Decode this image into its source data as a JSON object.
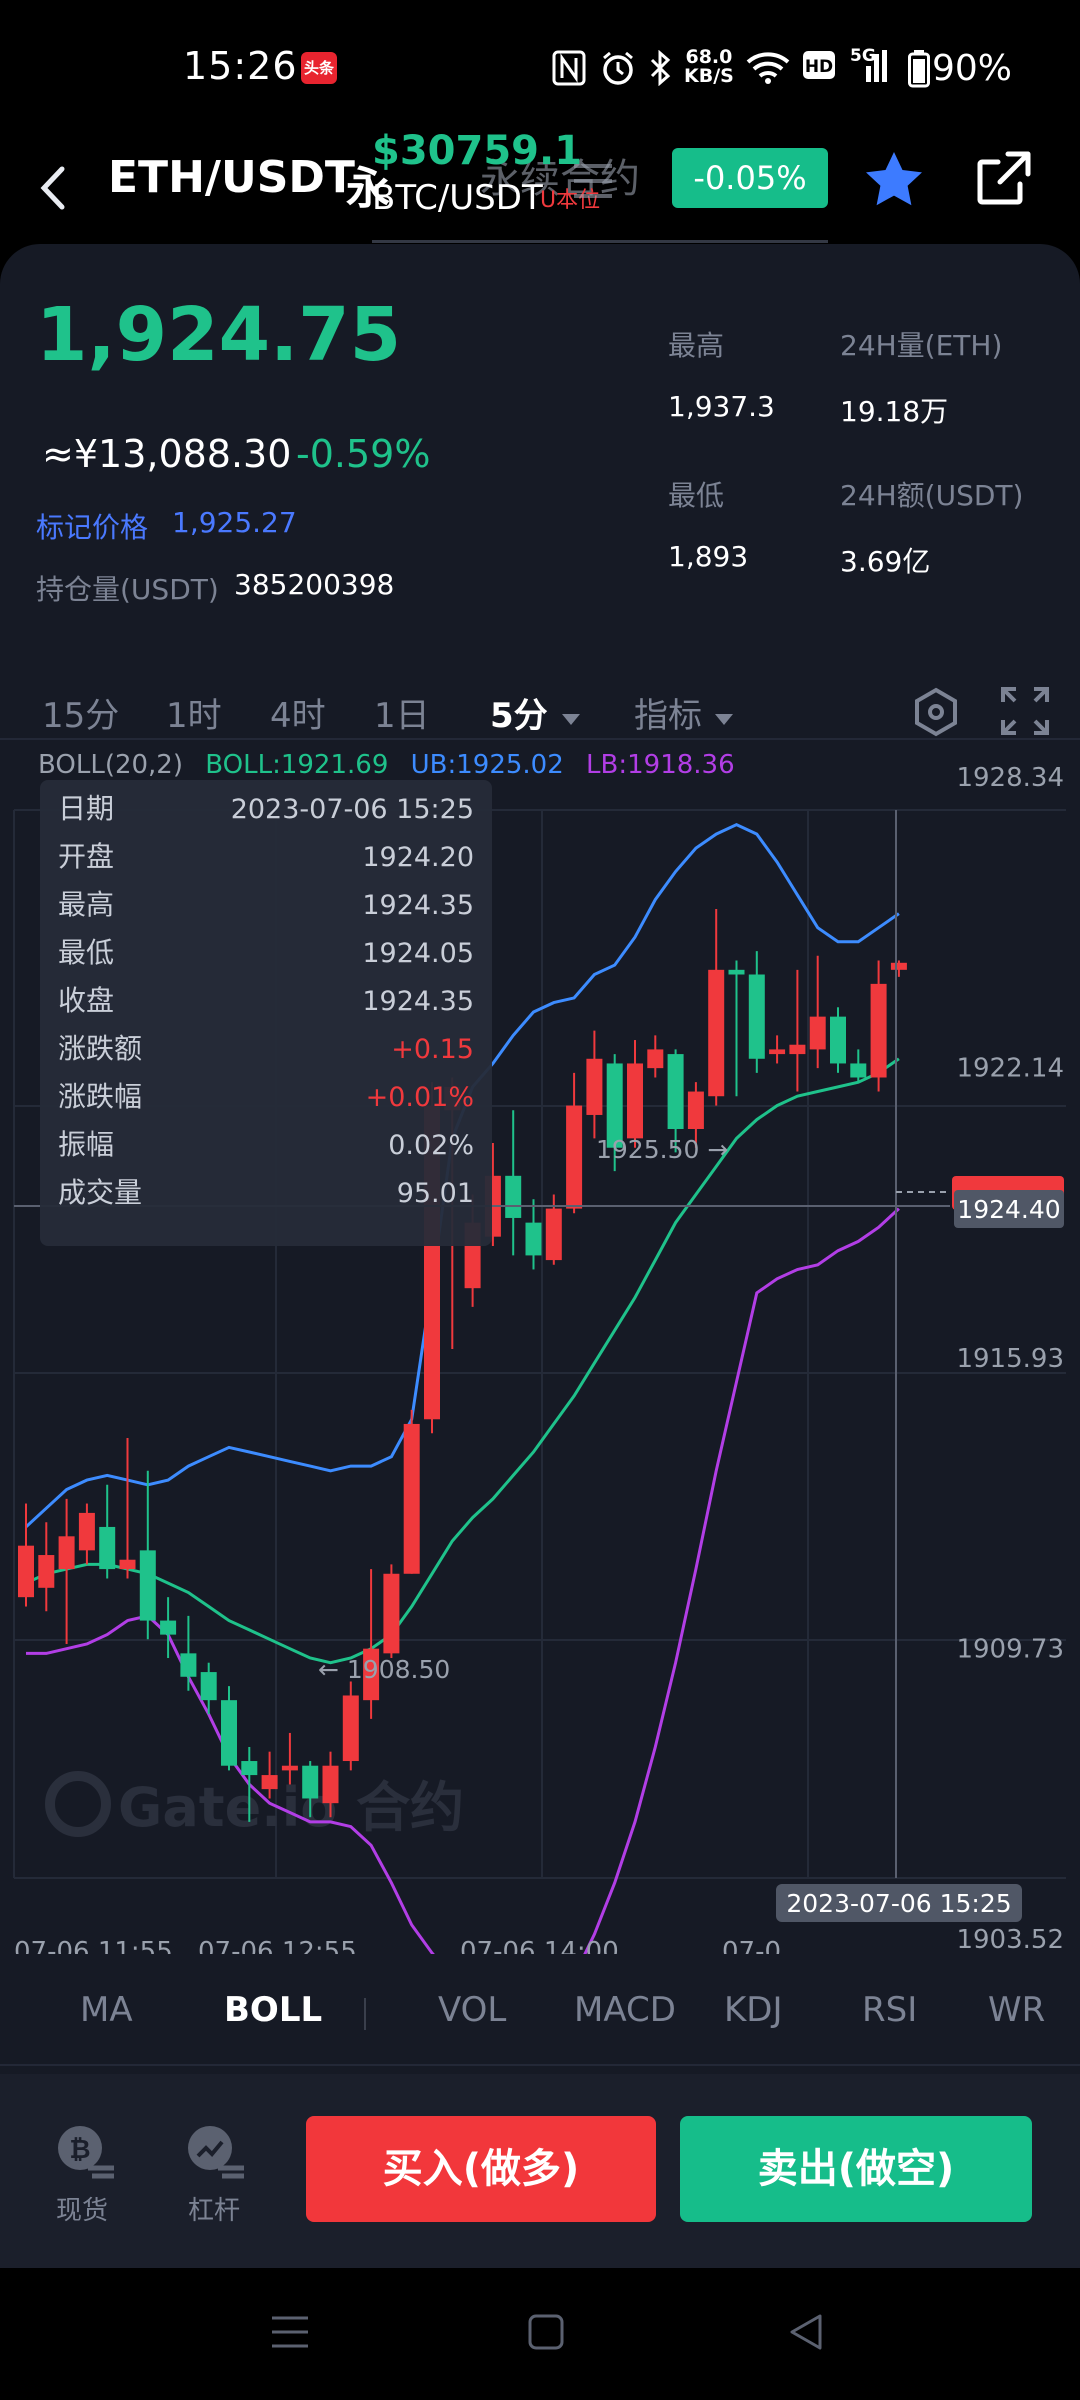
{
  "status_bar": {
    "time": "15:26",
    "toutiao_badge": "头条",
    "net_speed_value": "68.0",
    "net_speed_unit": "KB/S",
    "signal_label": "5G",
    "battery": "90%",
    "icons": [
      "nfc-icon",
      "alarm-icon",
      "bluetooth-icon",
      "wifi-icon",
      "hd-icon",
      "signal-icon",
      "battery-icon"
    ]
  },
  "header": {
    "pair": "ETH/USDT",
    "pair_suffix": "永",
    "overlay_price": "$30759.1",
    "overlay_subtitle": "永续合约",
    "overlay_pair": "BTC/USDT",
    "overlay_tag": "U本位",
    "change_pill": "-0.05%"
  },
  "ticker": {
    "last_price": "1,924.75",
    "cny_price": "≈¥13,088.30",
    "cny_change": "-0.59%",
    "mark_label": "标记价格",
    "mark_value": "1,925.27",
    "oi_label": "持仓量(USDT)",
    "oi_value": "385200398",
    "high_label": "最高",
    "high_value": "1,937.3",
    "vol_label": "24H量(ETH)",
    "vol_value": "19.18万",
    "low_label": "最低",
    "low_value": "1,893",
    "turnover_label": "24H额(USDT)",
    "turnover_value": "3.69亿"
  },
  "timeframes": {
    "items": [
      "15分",
      "1时",
      "4时",
      "1日"
    ],
    "selected": "5分",
    "indicator_menu": "指标"
  },
  "boll_legend": {
    "name": "BOLL(20,2)",
    "mid": "BOLL:1921.69",
    "upper": "UB:1925.02",
    "lower": "LB:1918.36"
  },
  "tooltip": {
    "rows": [
      {
        "label": "日期",
        "value": "2023-07-06 15:25"
      },
      {
        "label": "开盘",
        "value": "1924.20"
      },
      {
        "label": "最高",
        "value": "1924.35"
      },
      {
        "label": "最低",
        "value": "1924.05"
      },
      {
        "label": "收盘",
        "value": "1924.35"
      },
      {
        "label": "涨跌额",
        "value": "+0.15"
      },
      {
        "label": "涨跌幅",
        "value": "+0.01%"
      },
      {
        "label": "振幅",
        "value": "0.02%"
      },
      {
        "label": "成交量",
        "value": "95.01"
      }
    ]
  },
  "chart_labels": {
    "max_label": "1925.50 →",
    "min_label": "← 1908.50",
    "crosshair_price": "1924.40",
    "crosshair_time": "2023-07-06 15:25",
    "watermark": "Gate.io 合约"
  },
  "chart_data": {
    "type": "candlestick",
    "y_ticks": [
      "1928.34",
      "1922.14",
      "1915.93",
      "1909.73",
      "1903.52"
    ],
    "x_ticks": [
      "07-06 11:55",
      "07-06 12:55",
      "07-06 14:00",
      "07-0"
    ],
    "candles": [
      [
        1910.8,
        1911.9,
        1910.6,
        1912.8
      ],
      [
        1911.0,
        1911.7,
        1910.5,
        1912.4
      ],
      [
        1911.4,
        1912.1,
        1909.8,
        1912.9
      ],
      [
        1911.8,
        1912.6,
        1911.5,
        1912.8
      ],
      [
        1912.3,
        1911.4,
        1911.2,
        1913.2
      ],
      [
        1911.4,
        1911.6,
        1911.2,
        1914.2
      ],
      [
        1911.8,
        1910.3,
        1909.9,
        1913.5
      ],
      [
        1910.3,
        1910.0,
        1909.5,
        1910.8
      ],
      [
        1909.6,
        1909.1,
        1908.8,
        1910.4
      ],
      [
        1909.2,
        1908.6,
        1908.3,
        1909.4
      ],
      [
        1908.6,
        1907.2,
        1907.1,
        1908.9
      ],
      [
        1907.3,
        1907.0,
        1906.0,
        1907.6
      ],
      [
        1906.7,
        1907.0,
        1906.5,
        1907.5
      ],
      [
        1907.1,
        1907.2,
        1906.8,
        1907.9
      ],
      [
        1907.2,
        1906.5,
        1906.1,
        1907.3
      ],
      [
        1906.4,
        1907.2,
        1906.1,
        1907.5
      ],
      [
        1907.3,
        1908.7,
        1907.1,
        1909.0
      ],
      [
        1908.6,
        1909.7,
        1908.2,
        1911.4
      ],
      [
        1909.6,
        1911.3,
        1909.5,
        1911.5
      ],
      [
        1911.3,
        1914.5,
        1911.3,
        1914.8
      ],
      [
        1914.6,
        1921.3,
        1914.3,
        1921.8
      ],
      [
        1921.2,
        1921.7,
        1916.1,
        1921.9
      ],
      [
        1917.4,
        1918.8,
        1917.0,
        1919.4
      ],
      [
        1918.5,
        1919.8,
        1918.3,
        1920.5
      ],
      [
        1919.8,
        1918.9,
        1918.1,
        1921.2
      ],
      [
        1918.8,
        1918.1,
        1917.8,
        1919.3
      ],
      [
        1918.0,
        1919.1,
        1917.9,
        1919.4
      ],
      [
        1919.1,
        1921.3,
        1919.0,
        1922.0
      ],
      [
        1921.1,
        1922.3,
        1920.6,
        1922.9
      ],
      [
        1922.2,
        1920.4,
        1919.9,
        1922.4
      ],
      [
        1920.6,
        1922.2,
        1920.4,
        1922.7
      ],
      [
        1922.1,
        1922.5,
        1921.9,
        1922.8
      ],
      [
        1922.4,
        1920.8,
        1920.3,
        1922.5
      ],
      [
        1920.8,
        1921.6,
        1920.4,
        1921.8
      ],
      [
        1921.5,
        1924.2,
        1921.3,
        1925.5
      ],
      [
        1924.2,
        1924.1,
        1921.5,
        1924.4
      ],
      [
        1924.1,
        1922.3,
        1922.0,
        1924.6
      ],
      [
        1922.4,
        1922.5,
        1922.2,
        1922.8
      ],
      [
        1922.4,
        1922.6,
        1921.6,
        1924.2
      ],
      [
        1922.5,
        1923.2,
        1922.1,
        1924.5
      ],
      [
        1923.2,
        1922.2,
        1922.0,
        1923.4
      ],
      [
        1922.2,
        1921.9,
        1921.8,
        1922.5
      ],
      [
        1921.9,
        1923.9,
        1921.6,
        1924.4
      ],
      [
        1924.2,
        1924.35,
        1924.05,
        1924.4
      ]
    ],
    "upper_band": [
      1912.3,
      1912.7,
      1913.1,
      1913.3,
      1913.4,
      1913.3,
      1913.2,
      1913.3,
      1913.6,
      1913.8,
      1914.0,
      1913.9,
      1913.8,
      1913.7,
      1913.6,
      1913.5,
      1913.6,
      1913.6,
      1913.8,
      1914.6,
      1917.5,
      1920.6,
      1921.7,
      1922.2,
      1922.8,
      1923.3,
      1923.5,
      1923.6,
      1924.1,
      1924.3,
      1924.9,
      1925.7,
      1926.3,
      1926.8,
      1927.1,
      1927.3,
      1927.1,
      1926.5,
      1925.8,
      1925.1,
      1924.8,
      1924.8,
      1925.1,
      1925.4
    ],
    "mid_band": [
      1911.1,
      1911.3,
      1911.4,
      1911.5,
      1911.5,
      1911.4,
      1911.3,
      1911.1,
      1910.9,
      1910.6,
      1910.3,
      1910.1,
      1909.9,
      1909.7,
      1909.5,
      1909.4,
      1909.5,
      1909.7,
      1910.0,
      1910.6,
      1911.3,
      1912.0,
      1912.5,
      1912.9,
      1913.4,
      1913.9,
      1914.5,
      1915.1,
      1915.8,
      1916.5,
      1917.2,
      1918.0,
      1918.8,
      1919.4,
      1920.0,
      1920.6,
      1921.0,
      1921.3,
      1921.5,
      1921.6,
      1921.7,
      1921.8,
      1922.0,
      1922.3
    ],
    "lower_band": [
      1909.6,
      1909.6,
      1909.7,
      1909.8,
      1910.0,
      1910.3,
      1910.4,
      1910.0,
      1909.1,
      1908.3,
      1907.4,
      1906.8,
      1906.4,
      1906.2,
      1906.0,
      1906.0,
      1905.9,
      1905.5,
      1904.7,
      1903.8,
      1903.2,
      1902.7,
      1902.1,
      1901.9,
      1902.0,
      1901.9,
      1902.1,
      1902.7,
      1903.6,
      1904.7,
      1906.0,
      1907.6,
      1909.4,
      1911.4,
      1913.5,
      1915.4,
      1917.3,
      1917.6,
      1917.8,
      1917.9,
      1918.2,
      1918.4,
      1918.7,
      1919.1
    ]
  },
  "indicators": {
    "items": [
      "MA",
      "VOL",
      "MACD",
      "KDJ",
      "RSI",
      "WR"
    ],
    "selected": "BOLL"
  },
  "actions": {
    "spot_label": "现货",
    "leverage_label": "杠杆",
    "buy_label": "买入(做多)",
    "sell_label": "卖出(做空)"
  },
  "colors": {
    "up": "#f0393d",
    "down": "#1fc28b",
    "upper_band": "#3d8cff",
    "mid_band": "#1fc28b",
    "lower_band": "#b23ee6",
    "accent_blue": "#3d7bff"
  }
}
